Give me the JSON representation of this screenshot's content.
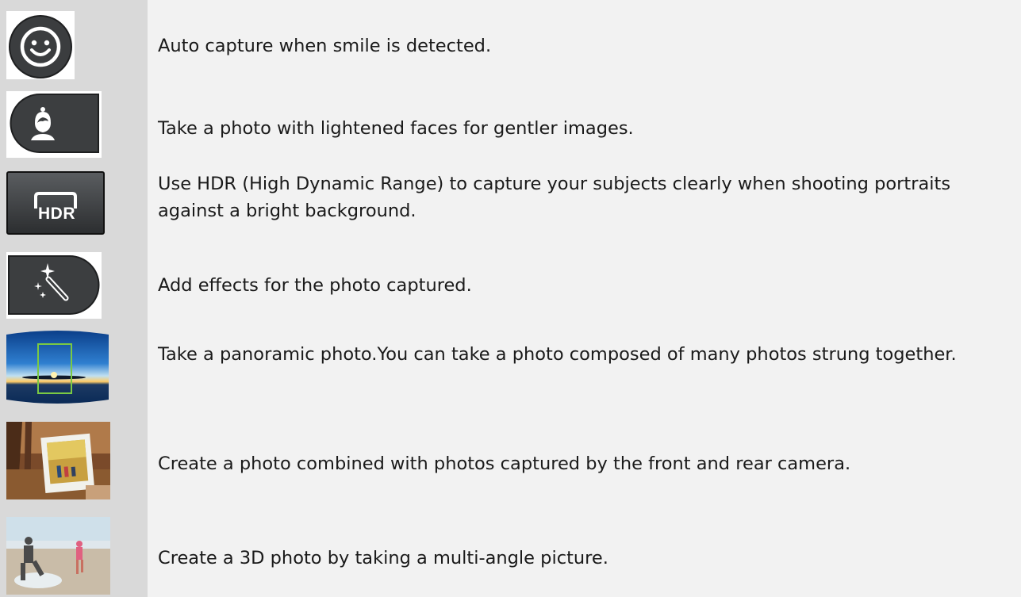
{
  "rows": [
    {
      "icon": "smile-icon",
      "text": "Auto capture when smile is detected."
    },
    {
      "icon": "face-beauty-icon",
      "text": "Take a photo with lightened faces for gentler images."
    },
    {
      "icon": "hdr-icon",
      "text": "Use HDR (High Dynamic Range) to capture your subjects clearly when shooting portraits against a bright background."
    },
    {
      "icon": "magic-wand-icon",
      "text": "Add effects for the photo captured."
    },
    {
      "icon": "panorama-thumbnail",
      "text": "Take a panoramic photo.You can take a photo composed of many photos strung together."
    },
    {
      "icon": "dual-camera-thumbnail",
      "text": "Create a photo combined with photos captured by the front and rear camera."
    },
    {
      "icon": "3d-photo-thumbnail",
      "text": "Create a 3D photo by taking a multi-angle picture."
    }
  ],
  "hdr_label": "HDR",
  "colors": {
    "icon_column": "#d9d9d9",
    "text_column": "#f2f2f2",
    "button_dark": "#3a3c3e"
  }
}
